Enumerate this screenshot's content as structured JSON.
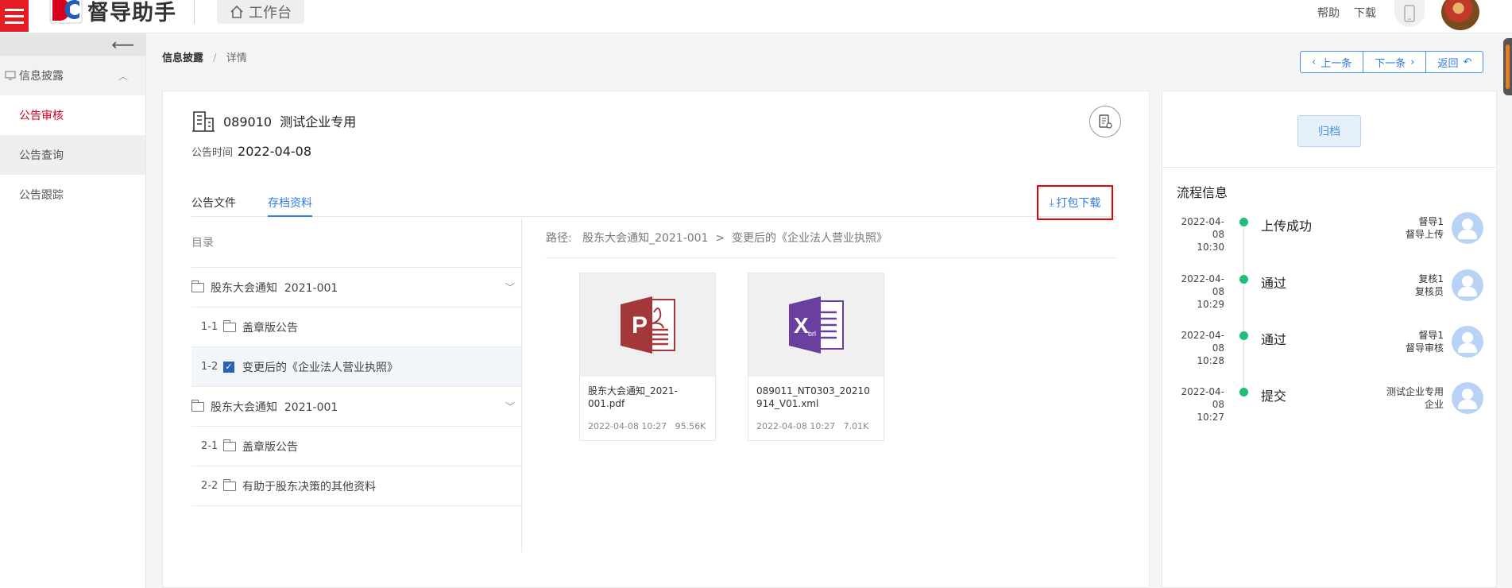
{
  "header": {
    "app_name": "督导助手",
    "workbench_label": "工作台",
    "help_label": "帮助",
    "download_label": "下载",
    "accent_color": "#e51c23",
    "phone_icon": "phone-icon"
  },
  "sidebar": {
    "collapse_icon": "arrow-left-icon",
    "group_label": "信息披露",
    "items": [
      {
        "label": "公告审核",
        "active": true
      },
      {
        "label": "公告查询",
        "active": false
      },
      {
        "label": "公告跟踪",
        "active": false
      }
    ]
  },
  "breadcrumb": {
    "root": "信息披露",
    "separator": "/",
    "current": "详情"
  },
  "nav": {
    "prev": "上一条",
    "next": "下一条",
    "back": "返回"
  },
  "detail": {
    "company": "089010  测试企业专用",
    "pubtime_label": "公告时间",
    "pubtime_value": "2022-04-08",
    "tabs": [
      "公告文件",
      "存档资料"
    ],
    "active_tab": "存档资料",
    "pack_download": "打包下载",
    "tree_header": "目录",
    "tree": [
      {
        "type": "group",
        "label": "股东大会通知  2021-001"
      },
      {
        "type": "item",
        "num": "1-1",
        "label": "盖章版公告",
        "checked": false
      },
      {
        "type": "item",
        "num": "1-2",
        "label": "变更后的《企业法人营业执照》",
        "checked": true
      },
      {
        "type": "group",
        "label": "股东大会通知  2021-001"
      },
      {
        "type": "item",
        "num": "2-1",
        "label": "盖章版公告",
        "checked": false
      },
      {
        "type": "item",
        "num": "2-2",
        "label": "有助于股东决策的其他资料",
        "checked": false
      }
    ],
    "path": "路径:   股东大会通知_2021-001  >  变更后的《企业法人营业执照》",
    "files": [
      {
        "name": "股东大会通知_2021-001.pdf",
        "meta": "2022-04-08 10:27   95.56K",
        "icon": "pdf-icon",
        "color": "#a4373a"
      },
      {
        "name": "089011_NT0303_20210914_V01.xml",
        "meta": "2022-04-08 10:27   7.01K",
        "icon": "xml-icon",
        "color": "#6b3fa0"
      }
    ]
  },
  "flow": {
    "archive_label": "归档",
    "title": "流程信息",
    "items": [
      {
        "date": "2022-04-08",
        "time": "10:30",
        "status": "上传成功",
        "user": "督导1",
        "role": "督导上传"
      },
      {
        "date": "2022-04-08",
        "time": "10:29",
        "status": "通过",
        "user": "复核1",
        "role": "复核员"
      },
      {
        "date": "2022-04-08",
        "time": "10:28",
        "status": "通过",
        "user": "督导1",
        "role": "督导审核"
      },
      {
        "date": "2022-04-08",
        "time": "10:27",
        "status": "提交",
        "user": "测试企业专用",
        "role": "企业"
      }
    ]
  }
}
